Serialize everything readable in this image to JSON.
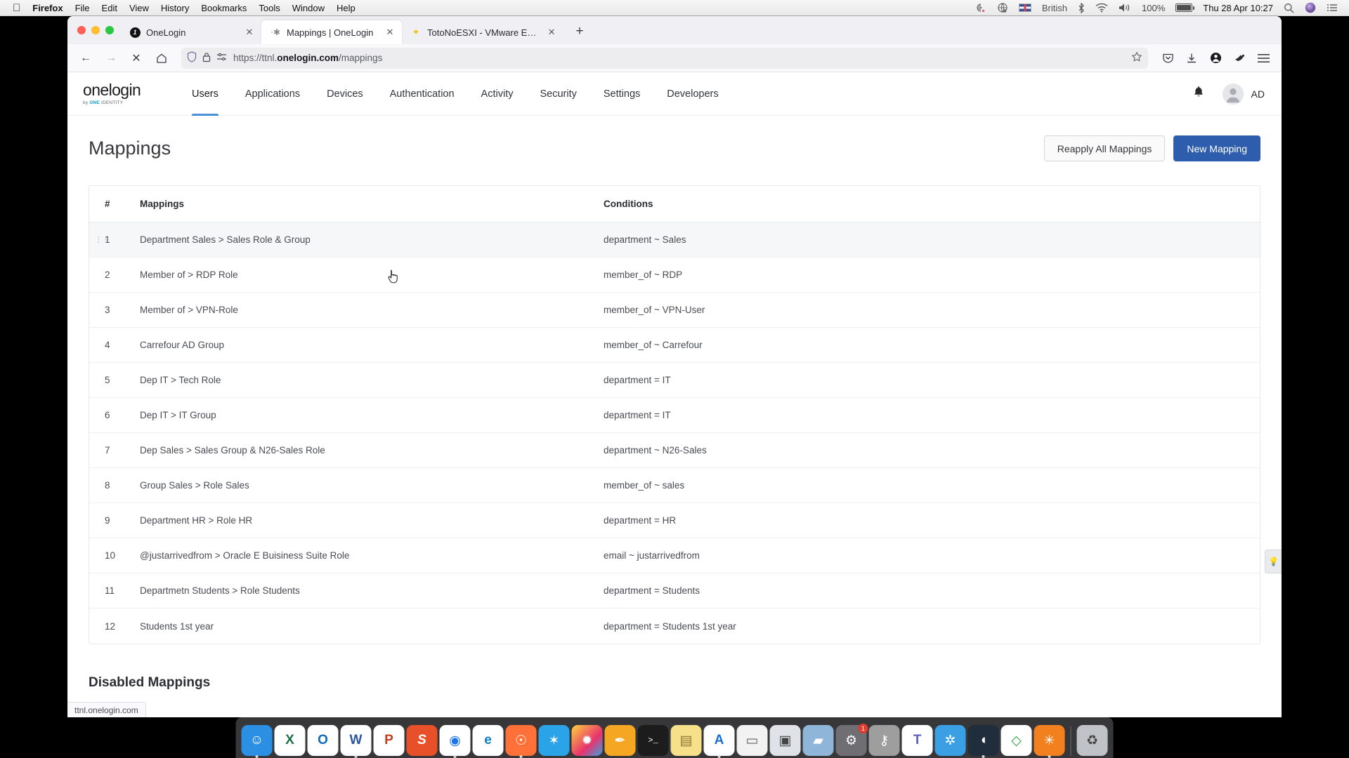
{
  "menubar": {
    "apple_icon": "apple-icon",
    "items": [
      "Firefox",
      "File",
      "Edit",
      "View",
      "History",
      "Bookmarks",
      "Tools",
      "Window",
      "Help"
    ],
    "status_icons": [
      "airplay-icon",
      "cloud-sync-icon",
      "bluetooth-icon",
      "wifi-icon",
      "volume-icon",
      "battery-icon",
      "search-icon",
      "siri-icon",
      "control-center-icon"
    ],
    "input_language": "British",
    "battery_percent": "100%",
    "clock": "Thu 28 Apr  10:27"
  },
  "browser": {
    "tabs": [
      {
        "title": "OneLogin",
        "favicon": "onelogin-favicon",
        "active": false,
        "close_label": "✕"
      },
      {
        "title": "Mappings | OneLogin",
        "favicon": "loading-favicon",
        "active": true,
        "close_label": "✕"
      },
      {
        "title": "TotoNoESXI - VMware ESXi",
        "favicon": "vmware-favicon",
        "active": false,
        "close_label": "✕"
      }
    ],
    "new_tab_label": "+",
    "nav": {
      "back": "←",
      "forward": "→",
      "stop": "✕",
      "home": "home-icon"
    },
    "url": {
      "prefix": "https://ttnl.",
      "domain": "onelogin.com",
      "suffix": "/mappings",
      "shield_icon": "shield-icon",
      "lock_icon": "lock-icon",
      "permissions_icon": "permissions-icon",
      "bookmark_icon": "star-icon"
    },
    "toolbar_icons": [
      "pocket-icon",
      "downloads-icon",
      "account-icon",
      "extension-icon",
      "menu-icon"
    ],
    "status_text": "ttnl.onelogin.com"
  },
  "app": {
    "logo": {
      "name": "onelogin",
      "tagline_prefix": "by",
      "tagline_brand": "ONE",
      "tagline_suffix": "IDENTITY"
    },
    "nav_items": [
      {
        "label": "Users",
        "active": true
      },
      {
        "label": "Applications",
        "active": false
      },
      {
        "label": "Devices",
        "active": false
      },
      {
        "label": "Authentication",
        "active": false
      },
      {
        "label": "Activity",
        "active": false
      },
      {
        "label": "Security",
        "active": false
      },
      {
        "label": "Settings",
        "active": false
      },
      {
        "label": "Developers",
        "active": false
      }
    ],
    "bell_icon": "notification-bell-icon",
    "avatar_icon": "user-avatar-icon",
    "user_initials": "AD",
    "page_title": "Mappings",
    "buttons": {
      "reapply": "Reapply All Mappings",
      "new_mapping": "New Mapping"
    },
    "table": {
      "headers": {
        "num": "#",
        "mappings": "Mappings",
        "conditions": "Conditions"
      },
      "rows": [
        {
          "num": "1",
          "mapping": "Department Sales > Sales Role & Group",
          "condition": "department ~ Sales",
          "hovered": true
        },
        {
          "num": "2",
          "mapping": "Member of > RDP Role",
          "condition": "member_of ~ RDP",
          "hovered": false
        },
        {
          "num": "3",
          "mapping": "Member of > VPN-Role",
          "condition": "member_of ~ VPN-User",
          "hovered": false
        },
        {
          "num": "4",
          "mapping": "Carrefour AD Group",
          "condition": "member_of ~ Carrefour",
          "hovered": false
        },
        {
          "num": "5",
          "mapping": "Dep IT > Tech Role",
          "condition": "department = IT",
          "hovered": false
        },
        {
          "num": "6",
          "mapping": "Dep IT > IT Group",
          "condition": "department = IT",
          "hovered": false
        },
        {
          "num": "7",
          "mapping": "Dep Sales > Sales Group & N26-Sales Role",
          "condition": "department ~ N26-Sales",
          "hovered": false
        },
        {
          "num": "8",
          "mapping": "Group Sales > Role Sales",
          "condition": "member_of ~ sales",
          "hovered": false
        },
        {
          "num": "9",
          "mapping": "Department HR > Role HR",
          "condition": "department = HR",
          "hovered": false
        },
        {
          "num": "10",
          "mapping": "@justarrivedfrom > Oracle E Buisiness Suite Role",
          "condition": "email ~ justarrivedfrom",
          "hovered": false
        },
        {
          "num": "11",
          "mapping": "Departmetn Students > Role Students",
          "condition": "department = Students",
          "hovered": false
        },
        {
          "num": "12",
          "mapping": "Students 1st year",
          "condition": "department = Students 1st year",
          "hovered": false
        }
      ]
    },
    "disabled_section_title": "Disabled Mappings",
    "helper_icon": "lightbulb-icon"
  },
  "colors": {
    "accent_blue": "#2f5dad",
    "nav_active_underline": "#4a90d9",
    "row_hover": "#f6f7f8",
    "brand_cyan": "#0d9ddb"
  },
  "dock": {
    "items": [
      {
        "name": "finder",
        "glyph": "☺",
        "bg": "#2b8fe3",
        "running": true
      },
      {
        "name": "excel",
        "glyph": "X",
        "bg": "#ffffff",
        "fg": "#1d7044",
        "running": false
      },
      {
        "name": "outlook",
        "glyph": "O",
        "bg": "#ffffff",
        "fg": "#0f6cbd",
        "running": false
      },
      {
        "name": "word",
        "glyph": "W",
        "bg": "#ffffff",
        "fg": "#2b579a",
        "running": true
      },
      {
        "name": "powerpoint",
        "glyph": "P",
        "bg": "#ffffff",
        "fg": "#c43e1c",
        "running": false
      },
      {
        "name": "sublime-text",
        "glyph": "S",
        "bg": "#e8502a",
        "running": false
      },
      {
        "name": "chrome",
        "glyph": "●",
        "bg": "#ffffff",
        "fg": "#1a73e8",
        "running": true
      },
      {
        "name": "edge",
        "glyph": "e",
        "bg": "#ffffff",
        "fg": "#0f80c1",
        "running": false
      },
      {
        "name": "firefox",
        "glyph": "◉",
        "bg": "#ff7139",
        "running": true
      },
      {
        "name": "safari",
        "glyph": "✶",
        "bg": "#2aa3e8",
        "running": false
      },
      {
        "name": "photos",
        "glyph": "✹",
        "bg": "#ffd43b",
        "running": false
      },
      {
        "name": "keynote",
        "glyph": "✒",
        "bg": "#f5a623",
        "running": false
      },
      {
        "name": "terminal",
        "glyph": ">_",
        "bg": "#1c1c1c",
        "running": false
      },
      {
        "name": "notes",
        "glyph": "▤",
        "bg": "#f7e08a",
        "running": false
      },
      {
        "name": "appstore",
        "glyph": "A",
        "bg": "#ffffff",
        "fg": "#1a6fd4",
        "running": true
      },
      {
        "name": "pages",
        "glyph": "▭",
        "bg": "#f2f2f2",
        "fg": "#555",
        "running": false
      },
      {
        "name": "preview",
        "glyph": "▣",
        "bg": "#dfe3e8",
        "fg": "#444",
        "running": false
      },
      {
        "name": "image-capture",
        "glyph": "▰",
        "bg": "#8fb6d8",
        "running": false
      },
      {
        "name": "system-preferences",
        "glyph": "⚙",
        "bg": "#6e6e73",
        "running": false,
        "badge": "1"
      },
      {
        "name": "keychain-access",
        "glyph": "⚷",
        "bg": "#9e9e9e",
        "running": false
      },
      {
        "name": "teams",
        "glyph": "T",
        "bg": "#ffffff",
        "fg": "#5b5fc7",
        "running": false
      },
      {
        "name": "vmware",
        "glyph": "✲",
        "bg": "#3aa0e3",
        "running": false
      },
      {
        "name": "remote-desktop",
        "glyph": "◖",
        "bg": "#1f2d3d",
        "running": true
      },
      {
        "name": "vscode",
        "glyph": "◇",
        "bg": "#ffffff",
        "fg": "#2f9e44",
        "running": false
      },
      {
        "name": "zoom-app",
        "glyph": "✳",
        "bg": "#f2801e",
        "running": true
      },
      {
        "name": "trash",
        "glyph": "♻",
        "bg": "#bfc3c7",
        "fg": "#444",
        "running": false
      }
    ]
  }
}
